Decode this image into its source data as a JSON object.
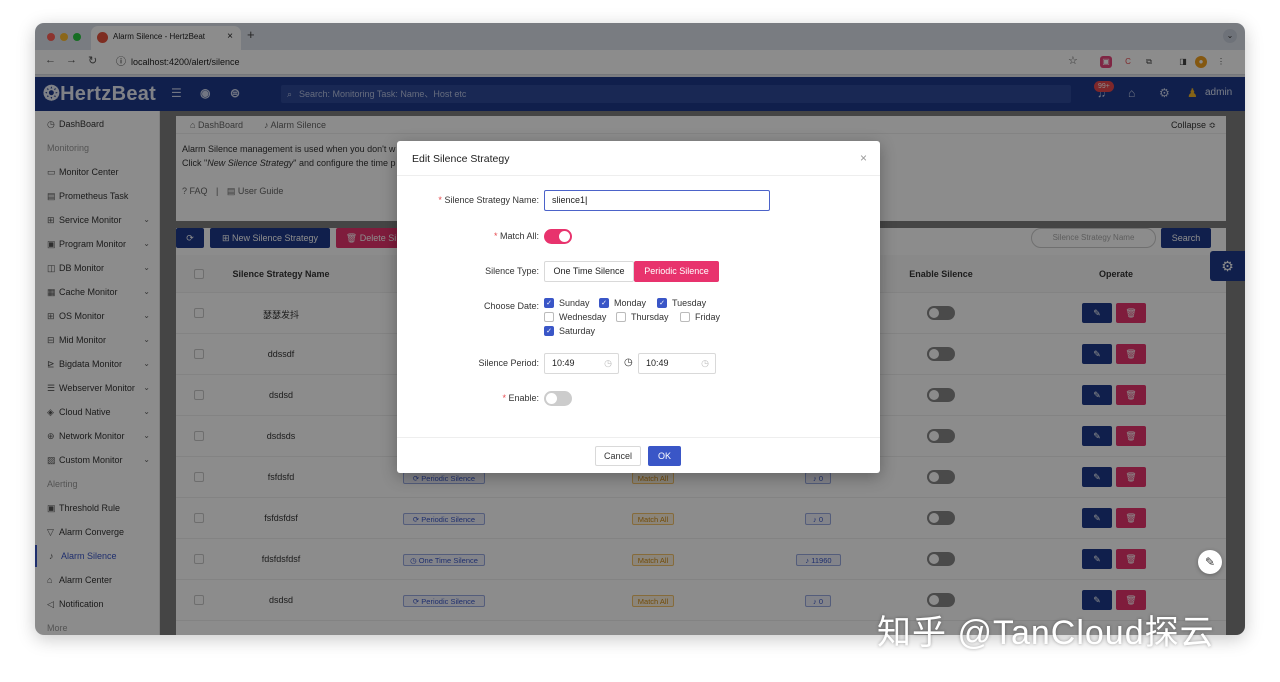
{
  "browser": {
    "tab_title": "Alarm Silence - HertzBeat",
    "tab_close": "×",
    "new_tab": "+",
    "url": "localhost:4200/alert/silence"
  },
  "header": {
    "logo": "HertzBeat",
    "search_placeholder": "Search: Monitoring Task: Name、Host etc",
    "badge": "99+",
    "user": "admin"
  },
  "sidebar": {
    "items": [
      {
        "label": "DashBoard",
        "icon": "◷",
        "group": false
      },
      {
        "label": "Monitoring",
        "group": true
      },
      {
        "label": "Monitor Center",
        "icon": "▭"
      },
      {
        "label": "Prometheus Task",
        "icon": "▤"
      },
      {
        "label": "Service Monitor",
        "icon": "⊞",
        "chevron": "⌄"
      },
      {
        "label": "Program Monitor",
        "icon": "▣",
        "chevron": "⌄"
      },
      {
        "label": "DB Monitor",
        "icon": "◫",
        "chevron": "⌄"
      },
      {
        "label": "Cache Monitor",
        "icon": "▦",
        "chevron": "⌄"
      },
      {
        "label": "OS Monitor",
        "icon": "⊞",
        "chevron": "⌄"
      },
      {
        "label": "Mid Monitor",
        "icon": "⊟",
        "chevron": "⌄"
      },
      {
        "label": "Bigdata Monitor",
        "icon": "⊵",
        "chevron": "⌄"
      },
      {
        "label": "Webserver Monitor",
        "icon": "☰",
        "chevron": "⌄"
      },
      {
        "label": "Cloud Native",
        "icon": "◈",
        "chevron": "⌄"
      },
      {
        "label": "Network Monitor",
        "icon": "⊕",
        "chevron": "⌄"
      },
      {
        "label": "Custom Monitor",
        "icon": "▨",
        "chevron": "⌄"
      },
      {
        "label": "Alerting",
        "group": true
      },
      {
        "label": "Threshold Rule",
        "icon": "▣"
      },
      {
        "label": "Alarm Converge",
        "icon": "▽"
      },
      {
        "label": "Alarm Silence",
        "icon": "♪",
        "active": true
      },
      {
        "label": "Alarm Center",
        "icon": "⌂"
      },
      {
        "label": "Notification",
        "icon": "◁"
      },
      {
        "label": "More",
        "group": true
      }
    ]
  },
  "breadcrumb": {
    "home": "DashBoard",
    "current": "Alarm Silence",
    "collapse": "Collapse ≎"
  },
  "intro": {
    "line1": "Alarm Silence management is used when you don't w",
    "line2a": "Click \"",
    "line2b": "New Silence Strategy",
    "line2c": "\" and configure the time p",
    "faq": "FAQ",
    "sep": "|",
    "guide": "User Guide"
  },
  "toolbar": {
    "refresh": "⟳",
    "new": "New Silence Strategy",
    "delete": "Delete Si",
    "search_placeholder": "Silence Strategy Name",
    "search": "Search"
  },
  "table": {
    "headers": {
      "name": "Silence Strategy Name",
      "enable": "Enable Silence",
      "operate": "Operate"
    },
    "rows": [
      {
        "name": "瑟瑟发抖",
        "type": "",
        "match": "",
        "count": ""
      },
      {
        "name": "ddssdf",
        "type": "",
        "match": "",
        "count": ""
      },
      {
        "name": "dsdsd",
        "type": "",
        "match": "",
        "count": ""
      },
      {
        "name": "dsdsds",
        "type": "",
        "match": "",
        "count": ""
      },
      {
        "name": "fsfdsfd",
        "type": "Periodic Silence",
        "match": "Match All",
        "count": "0"
      },
      {
        "name": "fsfdsfdsf",
        "type": "Periodic Silence",
        "match": "Match All",
        "count": "0"
      },
      {
        "name": "fdsfdsfdsf",
        "type": "One Time Silence",
        "match": "Match All",
        "count": "11960"
      },
      {
        "name": "dsdsd",
        "type": "Periodic Silence",
        "match": "Match All",
        "count": "0"
      }
    ]
  },
  "modal": {
    "title": "Edit Silence Strategy",
    "close": "×",
    "name_label": "Silence Strategy Name",
    "name_value": "slience1",
    "match_label": "Match All",
    "type_label": "Silence Type",
    "type_options": [
      "One Time Silence",
      "Periodic Silence"
    ],
    "date_label": "Choose Date",
    "days": [
      {
        "label": "Sunday",
        "checked": true
      },
      {
        "label": "Monday",
        "checked": true
      },
      {
        "label": "Tuesday",
        "checked": true
      },
      {
        "label": "Wednesday",
        "checked": false
      },
      {
        "label": "Thursday",
        "checked": false
      },
      {
        "label": "Friday",
        "checked": false
      },
      {
        "label": "Saturday",
        "checked": true
      }
    ],
    "period_label": "Silence Period",
    "start": "10:49",
    "end": "10:49",
    "enable_label": "Enable",
    "colon": ":",
    "cancel": "Cancel",
    "ok": "OK"
  },
  "watermark": "知乎 @TanCloud探云",
  "colors": {
    "primary": "#3a56c7",
    "danger": "#e8336d",
    "header": "#1e3a8a"
  }
}
